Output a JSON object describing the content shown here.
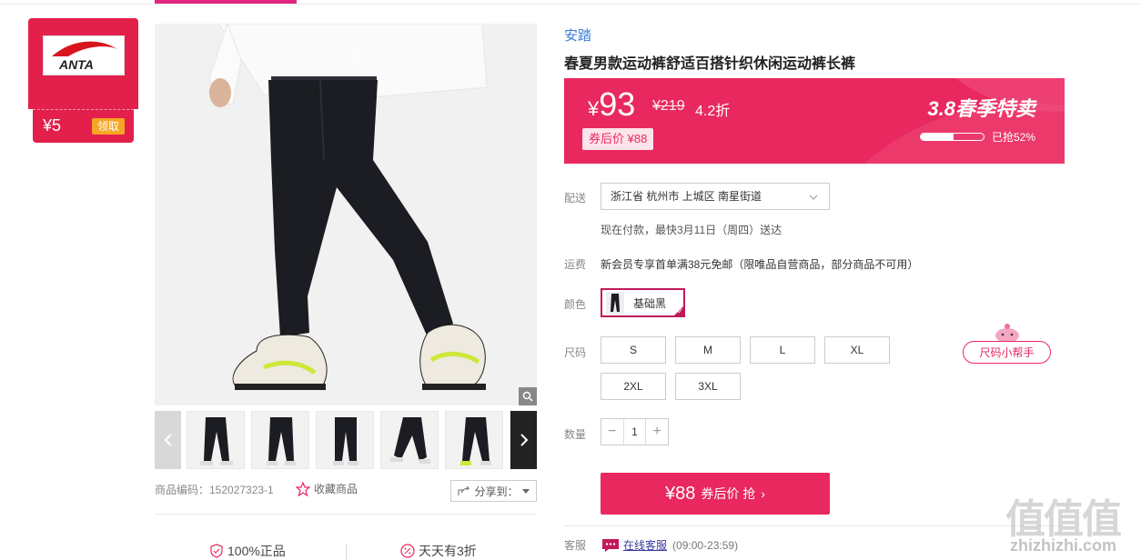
{
  "brand_card": {
    "logo_text": "ANTA",
    "coupon_amount": "¥5",
    "claim_label": "领取"
  },
  "gallery": {
    "thumb_count": 6
  },
  "product_code": "商品编码：152027323-1",
  "favorite_label": "收藏商品",
  "share_label": "分享到：",
  "guarantees": [
    "100%正品",
    "天天有3折"
  ],
  "brand_name": "安踏",
  "title": "春夏男款运动裤舒适百搭针织休闲运动裤长裤",
  "price_banner": {
    "price_yen": "¥",
    "price_value": "93",
    "original_price": "¥219",
    "discount": "4.2折",
    "coupon_price": "券后价 ¥88",
    "event": "3.8春季特卖",
    "sold_progress": 0.52,
    "sold_text": "已抢52%"
  },
  "labels": {
    "delivery": "配送",
    "shipping": "运费",
    "color": "颜色",
    "size": "尺码",
    "quantity": "数量",
    "service": "客服"
  },
  "delivery": {
    "address": "浙江省 杭州市 上城区 南星街道",
    "note": "现在付款，最快3月11日（周四）送达"
  },
  "shipping_text": "新会员专享首单满38元免邮（限唯品自营商品，部分商品不可用）",
  "color": {
    "selected": "基础黑"
  },
  "sizes": [
    "S",
    "M",
    "L",
    "XL",
    "2XL",
    "3XL"
  ],
  "size_helper": "尺码小帮手",
  "quantity": {
    "minus": "−",
    "value": "1",
    "plus": "+"
  },
  "buy_button": {
    "amount": "¥88",
    "text": "券后价 抢",
    "arrow": "›"
  },
  "customer_service": {
    "link": "在线客服",
    "hours": "(09:00-23:59)"
  },
  "watermark": {
    "cn": "值值值",
    "en": "zhizhizhi.com"
  },
  "colors": {
    "accent": "#e9285f",
    "brand_red": "#e2204b",
    "selected_border": "#c2185b",
    "link_blue": "#3a7bd5"
  }
}
